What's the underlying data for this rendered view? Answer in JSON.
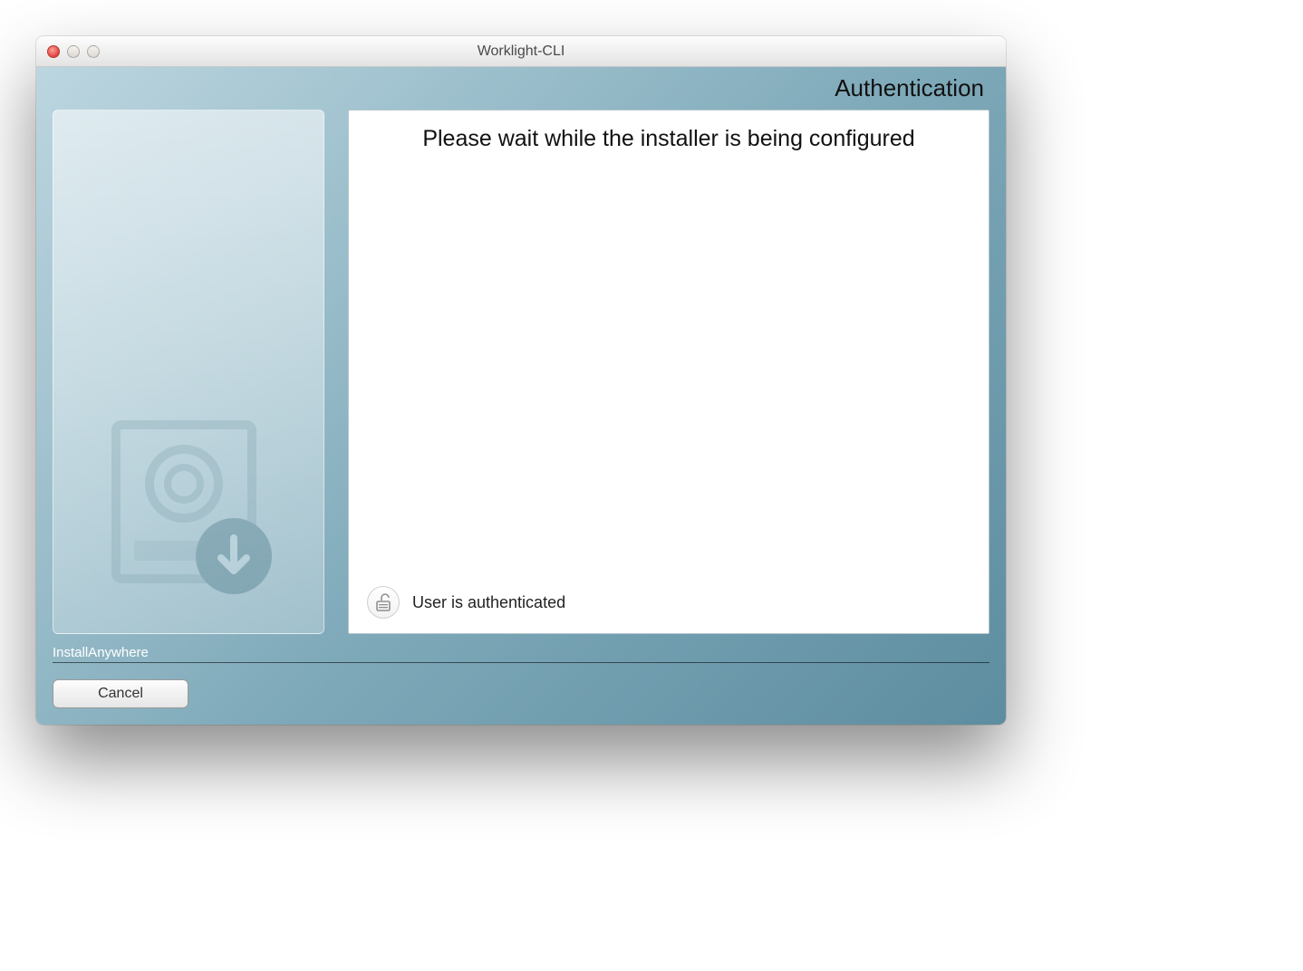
{
  "window": {
    "title": "Worklight-CLI"
  },
  "header": {
    "step_title": "Authentication"
  },
  "main": {
    "message": "Please wait while the installer is being configured",
    "status_text": "User is authenticated"
  },
  "footer": {
    "brand": "InstallAnywhere",
    "cancel_label": "Cancel"
  },
  "icons": {
    "close": "close-icon",
    "minimize": "minimize-icon",
    "zoom": "zoom-icon",
    "lock": "unlock-icon",
    "install_graphic": "install-download-icon"
  }
}
